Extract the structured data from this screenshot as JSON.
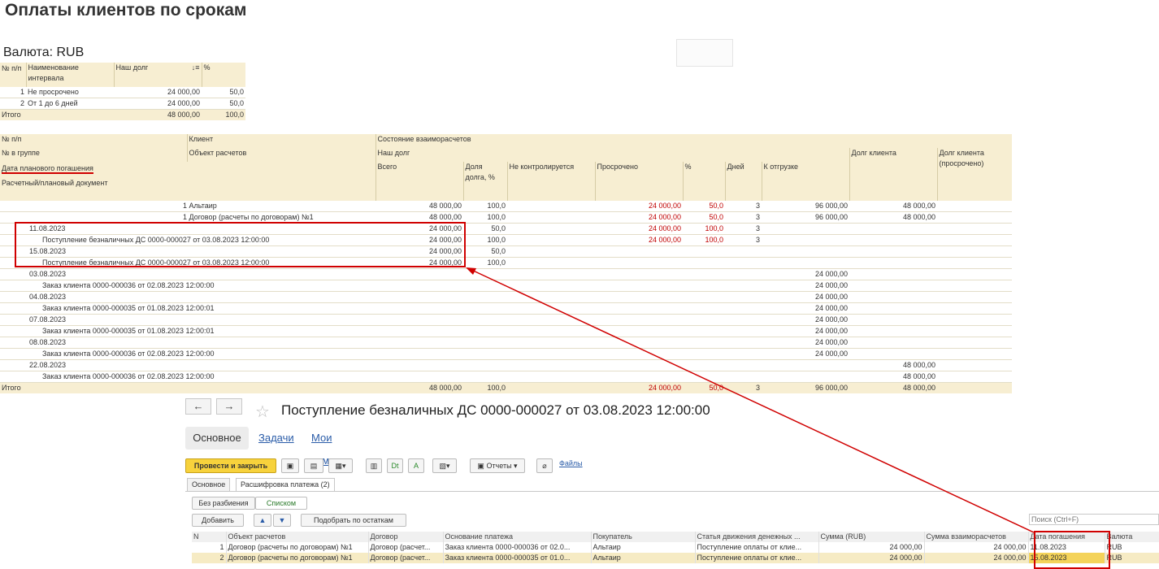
{
  "page": {
    "title": "Оплаты клиентов по срокам",
    "currency": "Валюта: RUB"
  },
  "summary": {
    "headers": [
      "№ п/п",
      "Наименование интервала",
      "Наш долг",
      "%"
    ],
    "rows": [
      {
        "n": "1",
        "name": "Не просрочено",
        "debt": "24 000,00",
        "pct": "50,0"
      },
      {
        "n": "2",
        "name": "От 1 до 6 дней",
        "debt": "24 000,00",
        "pct": "50,0"
      }
    ],
    "total": {
      "label": "Итого",
      "debt": "48 000,00",
      "pct": "100,0"
    }
  },
  "main": {
    "header": {
      "np": "№ п/п",
      "client": "Клиент",
      "state": "Состояние взаиморасчетов",
      "ingroup": "№ в группе",
      "object": "Объект расчетов",
      "ourdebt": "Наш долг",
      "clientdebt": "Долг клиента",
      "date": "Дата планового погашения",
      "total": "Всего",
      "share": "Доля долга, %",
      "notctl": "Не контролируется",
      "overdue": "Просрочено",
      "pct": "%",
      "days": "Дней",
      "ship": "К отгрузке",
      "clientdebt_over": "Долг клиента (просрочено)",
      "doc": "Расчетный/плановый документ"
    },
    "rows": [
      {
        "label": "1 Альтаир",
        "total": "48 000,00",
        "share": "100,0",
        "over": "24 000,00",
        "pct": "50,0",
        "days": "3",
        "ship": "96 000,00",
        "cdebt": "48 000,00"
      },
      {
        "label": "1     Договор (расчеты по договорам) №1",
        "total": "48 000,00",
        "share": "100,0",
        "over": "24 000,00",
        "pct": "50,0",
        "days": "3",
        "ship": "96 000,00",
        "cdebt": "48 000,00"
      },
      {
        "label": "11.08.2023",
        "total": "24 000,00",
        "share": "50,0",
        "over": "24 000,00",
        "pct": "100,0",
        "days": "3",
        "ship": "",
        "cdebt": ""
      },
      {
        "label": "Поступление безналичных ДС 0000-000027 от 03.08.2023 12:00:00",
        "total": "24 000,00",
        "share": "100,0",
        "over": "24 000,00",
        "pct": "100,0",
        "days": "3",
        "ship": "",
        "cdebt": ""
      },
      {
        "label": "15.08.2023",
        "total": "24 000,00",
        "share": "50,0",
        "over": "",
        "pct": "",
        "days": "",
        "ship": "",
        "cdebt": ""
      },
      {
        "label": "Поступление безналичных ДС 0000-000027 от 03.08.2023 12:00:00",
        "total": "24 000,00",
        "share": "100,0",
        "over": "",
        "pct": "",
        "days": "",
        "ship": "",
        "cdebt": ""
      },
      {
        "label": "03.08.2023",
        "total": "",
        "share": "",
        "over": "",
        "pct": "",
        "days": "",
        "ship": "24 000,00",
        "cdebt": ""
      },
      {
        "label": "Заказ клиента 0000-000036 от 02.08.2023 12:00:00",
        "total": "",
        "share": "",
        "over": "",
        "pct": "",
        "days": "",
        "ship": "24 000,00",
        "cdebt": ""
      },
      {
        "label": "04.08.2023",
        "total": "",
        "share": "",
        "over": "",
        "pct": "",
        "days": "",
        "ship": "24 000,00",
        "cdebt": ""
      },
      {
        "label": "Заказ клиента 0000-000035 от 01.08.2023 12:00:01",
        "total": "",
        "share": "",
        "over": "",
        "pct": "",
        "days": "",
        "ship": "24 000,00",
        "cdebt": ""
      },
      {
        "label": "07.08.2023",
        "total": "",
        "share": "",
        "over": "",
        "pct": "",
        "days": "",
        "ship": "24 000,00",
        "cdebt": ""
      },
      {
        "label": "Заказ клиента 0000-000035 от 01.08.2023 12:00:01",
        "total": "",
        "share": "",
        "over": "",
        "pct": "",
        "days": "",
        "ship": "24 000,00",
        "cdebt": ""
      },
      {
        "label": "08.08.2023",
        "total": "",
        "share": "",
        "over": "",
        "pct": "",
        "days": "",
        "ship": "24 000,00",
        "cdebt": ""
      },
      {
        "label": "Заказ клиента 0000-000036 от 02.08.2023 12:00:00",
        "total": "",
        "share": "",
        "over": "",
        "pct": "",
        "days": "",
        "ship": "24 000,00",
        "cdebt": ""
      },
      {
        "label": "22.08.2023",
        "total": "",
        "share": "",
        "over": "",
        "pct": "",
        "days": "",
        "ship": "",
        "cdebt": "48 000,00"
      },
      {
        "label": "Заказ клиента 0000-000036 от 02.08.2023 12:00:00",
        "total": "",
        "share": "",
        "over": "",
        "pct": "",
        "days": "",
        "ship": "",
        "cdebt": "48 000,00"
      }
    ],
    "total": {
      "label": "Итого",
      "total": "48 000,00",
      "share": "100,0",
      "over": "24 000,00",
      "pct": "50,0",
      "days": "3",
      "ship": "96 000,00",
      "cdebt": "48 000,00"
    }
  },
  "doc": {
    "title": "Поступление безналичных ДС 0000-000027 от 03.08.2023 12:00:00",
    "back": "←",
    "fwd": "→",
    "star": "☆",
    "tabs": {
      "main": "Основное",
      "tasks": "Задачи",
      "notes": "Мои заметки"
    },
    "toolbar": {
      "post_close": "Провести и закрыть",
      "reports": "Отчеты",
      "files": "Файлы"
    },
    "subtabs": {
      "main": "Основное",
      "breakdown": "Расшифровка платежа (2)"
    },
    "split": {
      "none": "Без разбиения",
      "list": "Списком"
    },
    "add": "Добавить",
    "pick": "Подобрать по остаткам",
    "search_placeholder": "Поиск (Ctrl+F)",
    "columns": [
      "N",
      "Объект расчетов",
      "Договор",
      "Основание платежа",
      "Покупатель",
      "Статья движения денежных ...",
      "Сумма (RUB)",
      "Сумма взаиморасчетов",
      "Дата погашения",
      "Валюта"
    ],
    "rows": [
      [
        "1",
        "Договор (расчеты по договорам) №1",
        "Договор (расчет...",
        "Заказ клиента 0000-000036 от 02.0...",
        "Альтаир",
        "Поступление оплаты от клие...",
        "24 000,00",
        "24 000,00",
        "11.08.2023",
        "RUB"
      ],
      [
        "2",
        "Договор (расчеты по договорам) №1",
        "Договор (расчет...",
        "Заказ клиента 0000-000035 от 01.0...",
        "Альтаир",
        "Поступление оплаты от клие...",
        "24 000,00",
        "24 000,00",
        "15.08.2023",
        "RUB"
      ]
    ]
  }
}
